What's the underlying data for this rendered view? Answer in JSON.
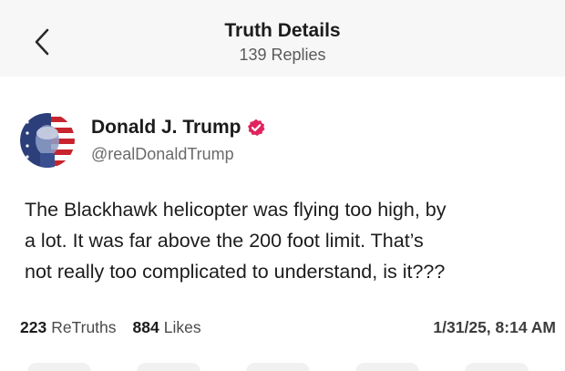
{
  "header": {
    "title": "Truth Details",
    "subtitle": "139 Replies"
  },
  "author": {
    "name": "Donald J. Trump",
    "handle": "@realDonaldTrump",
    "verified_color": "#e0245e"
  },
  "post": {
    "lines": [
      "The Blackhawk helicopter was flying too high, by",
      "a lot. It was far above the 200 foot limit. That’s",
      "not really too complicated to understand, is it???"
    ]
  },
  "stats": {
    "retruths_count": "223",
    "retruths_label": "ReTruths",
    "likes_count": "884",
    "likes_label": "Likes",
    "timestamp": "1/31/25, 8:14 AM"
  },
  "icons": {
    "back": "chevron-left-icon",
    "verified": "verified-check-icon"
  }
}
